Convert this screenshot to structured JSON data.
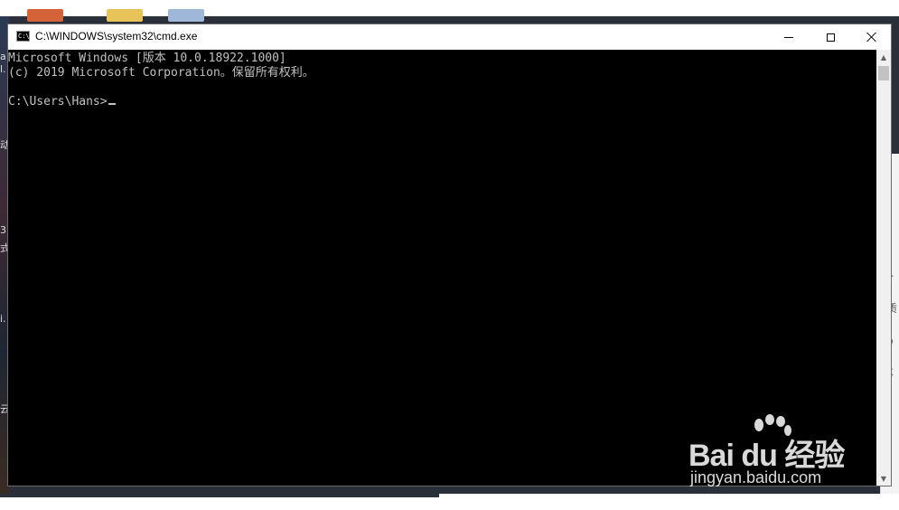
{
  "window": {
    "title": "C:\\WINDOWS\\system32\\cmd.exe",
    "icon": "cmd-icon",
    "controls": [
      "minimize",
      "maximize",
      "close"
    ]
  },
  "console": {
    "lines": [
      "Microsoft Windows [版本 10.0.18922.1000]",
      "(c) 2019 Microsoft Corporation。保留所有权利。",
      "",
      "C:\\Users\\Hans>"
    ],
    "text_color": "#c0c0c0",
    "background": "#000000"
  },
  "watermark": {
    "brand": "Bai du 经验",
    "site": "jingyan.baidu.com"
  },
  "background_fragments": {
    "left": [
      "a",
      "l.",
      "动",
      "3.",
      "式",
      "i.",
      "云"
    ],
    "right": [
      "介",
      "/质",
      "/b",
      "事"
    ]
  }
}
